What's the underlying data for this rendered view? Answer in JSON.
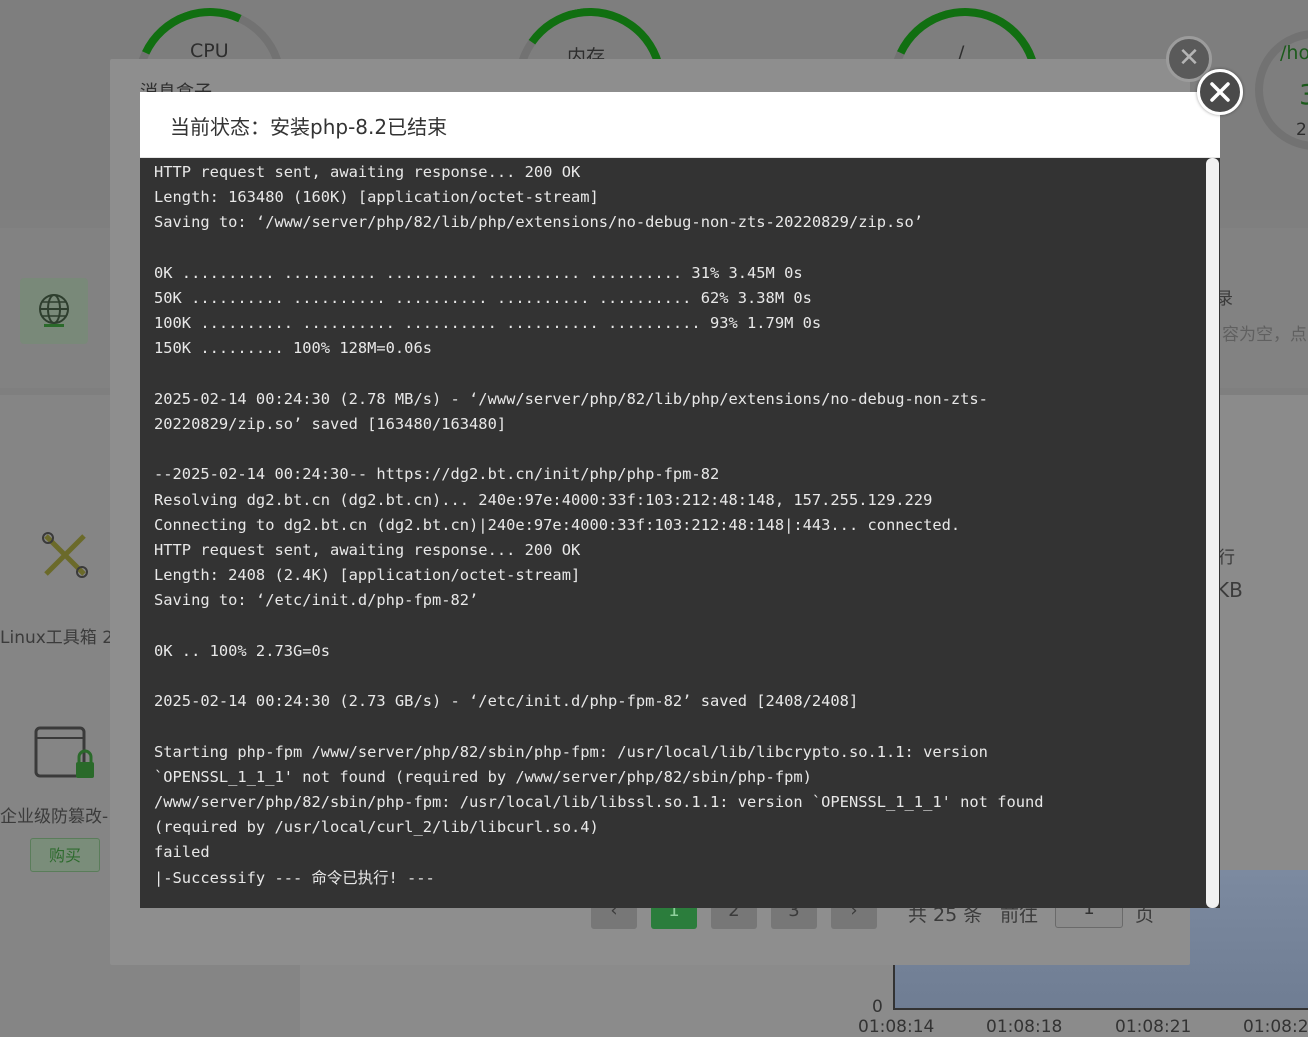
{
  "background": {
    "gauges": [
      {
        "label": "CPU"
      },
      {
        "label": "内存"
      },
      {
        "label": "/"
      },
      {
        "label": "/ho"
      }
    ],
    "gauge_right_digits": [
      "3",
      "2"
    ],
    "tools": {
      "linux_toolbox": "Linux工具箱 2",
      "tamper_protect": "企业级防篡改-",
      "buy_button": "购买"
    },
    "right_texts": {
      "r1": "录",
      "r2": "容为空，点",
      "r3": "行",
      "r4": "KB"
    },
    "pagination": {
      "prev": "‹",
      "pages": [
        "1",
        "2",
        "3"
      ],
      "next": "›",
      "total": "共 25 条",
      "goto": "前往",
      "page_input": "1",
      "page_suffix": "页"
    },
    "chart_axis": {
      "y_zero": "0",
      "x_ticks": [
        "01:08:14",
        "01:08:18",
        "01:08:21",
        "01:08:2"
      ]
    }
  },
  "outer_dialog": {
    "title": "消息盒子"
  },
  "dialog": {
    "title": "当前状态：安装php-8.2已结束",
    "log": "HTTP request sent, awaiting response... 200 OK\nLength: 163480 (160K) [application/octet-stream]\nSaving to: ‘/www/server/php/82/lib/php/extensions/no-debug-non-zts-20220829/zip.so’\n\n0K .......... .......... .......... .......... .......... 31% 3.45M 0s\n50K .......... .......... .......... .......... .......... 62% 3.38M 0s\n100K .......... .......... .......... .......... .......... 93% 1.79M 0s\n150K ......... 100% 128M=0.06s\n\n2025-02-14 00:24:30 (2.78 MB/s) - ‘/www/server/php/82/lib/php/extensions/no-debug-non-zts-\n20220829/zip.so’ saved [163480/163480]\n\n--2025-02-14 00:24:30-- https://dg2.bt.cn/init/php/php-fpm-82\nResolving dg2.bt.cn (dg2.bt.cn)... 240e:97e:4000:33f:103:212:48:148, 157.255.129.229\nConnecting to dg2.bt.cn (dg2.bt.cn)|240e:97e:4000:33f:103:212:48:148|:443... connected.\nHTTP request sent, awaiting response... 200 OK\nLength: 2408 (2.4K) [application/octet-stream]\nSaving to: ‘/etc/init.d/php-fpm-82’\n\n0K .. 100% 2.73G=0s\n\n2025-02-14 00:24:30 (2.73 GB/s) - ‘/etc/init.d/php-fpm-82’ saved [2408/2408]\n\nStarting php-fpm /www/server/php/82/sbin/php-fpm: /usr/local/lib/libcrypto.so.1.1: version\n`OPENSSL_1_1_1' not found (required by /www/server/php/82/sbin/php-fpm)\n/www/server/php/82/sbin/php-fpm: /usr/local/lib/libssl.so.1.1: version `OPENSSL_1_1_1' not found\n(required by /usr/local/curl_2/lib/libcurl.so.4)\nfailed\n|-Successify --- 命令已执行! ---"
  },
  "colors": {
    "terminal_bg": "#333333",
    "terminal_fg": "#e8e8e8",
    "accent_green": "#20a53a",
    "overlay": "#7f7f7f"
  },
  "icons": {
    "close": "close-icon",
    "globe": "globe-icon",
    "tools": "tools-icon",
    "lock": "lock-icon"
  }
}
